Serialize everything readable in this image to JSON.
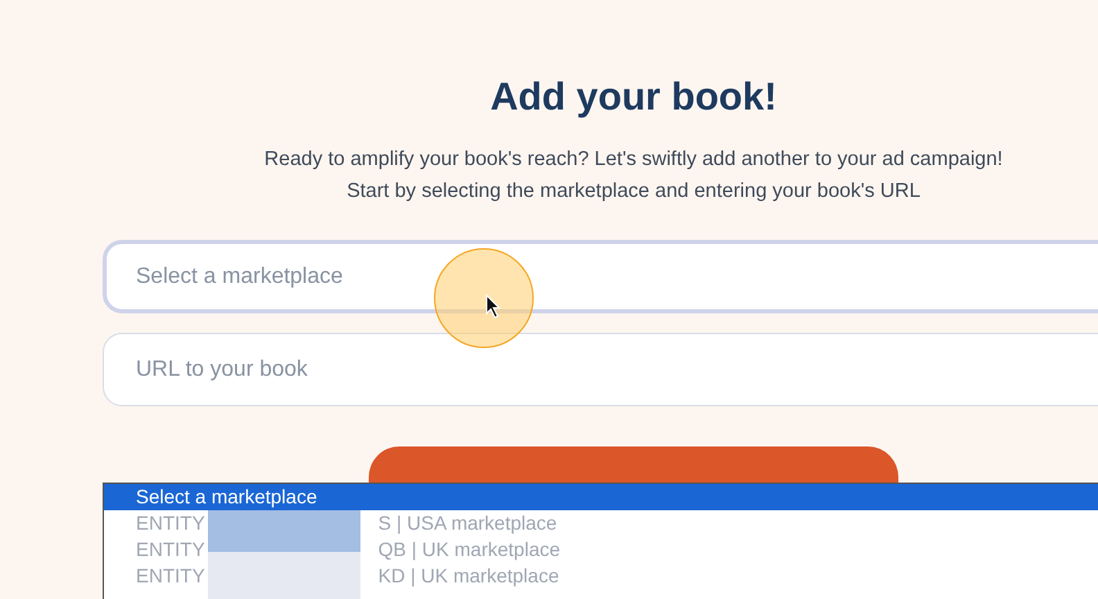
{
  "heading": "Add your book!",
  "subtitle": [
    "Ready to amplify your book's reach? Let's swiftly add another to your ad campaign!",
    "Start by selecting the marketplace and entering your book's URL"
  ],
  "fields": [
    {
      "placeholder": "Select a marketplace",
      "focused": true
    },
    {
      "placeholder": "URL to your book",
      "focused": false
    }
  ],
  "dropdown": {
    "options": [
      {
        "kind": "plain",
        "text": "Select a marketplace",
        "selected": true
      },
      {
        "kind": "redacted",
        "prefix": "ENTITY",
        "suffix": "S | USA marketplace",
        "selected": false
      },
      {
        "kind": "redacted",
        "prefix": "ENTITY",
        "suffix": "QB | UK marketplace",
        "selected": false
      },
      {
        "kind": "redacted",
        "prefix": "ENTITY",
        "suffix": "KD | UK marketplace",
        "selected": false
      }
    ]
  }
}
